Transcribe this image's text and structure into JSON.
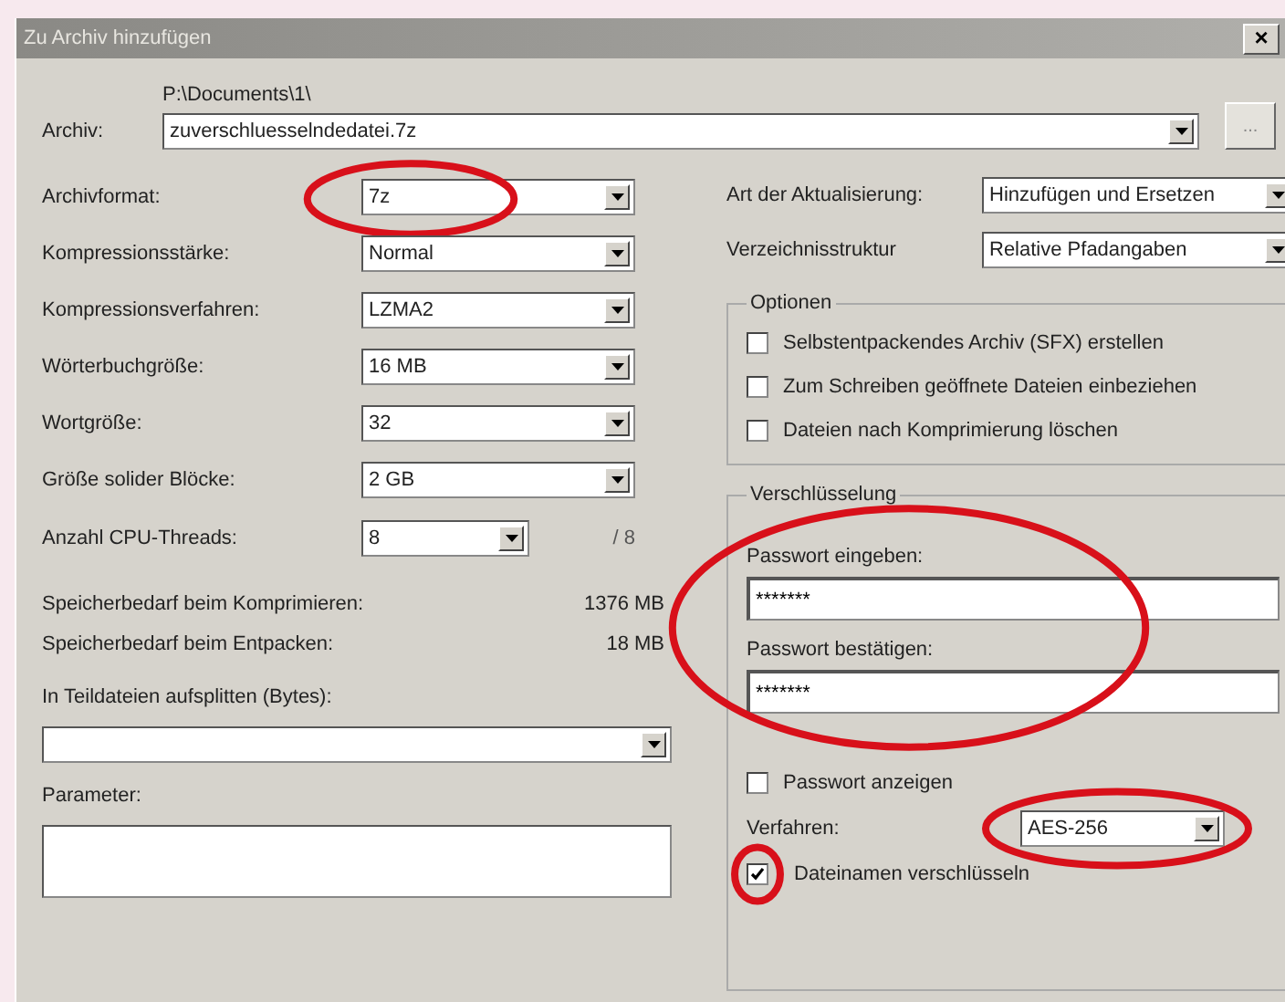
{
  "window": {
    "title": "Zu Archiv hinzufügen",
    "close": "×"
  },
  "archive": {
    "label": "Archiv:",
    "path": "P:\\Documents\\1\\",
    "value": "zuverschluesselndedatei.7z",
    "browse": "..."
  },
  "left_settings": [
    {
      "label": "Archivformat:",
      "value": "7z",
      "circled": true
    },
    {
      "label": "Kompressionsstärke:",
      "value": "Normal",
      "circled": false
    },
    {
      "label": "Kompressionsverfahren:",
      "value": "LZMA2",
      "circled": false
    },
    {
      "label": "Wörterbuchgröße:",
      "value": "16 MB",
      "circled": false
    },
    {
      "label": "Wortgröße:",
      "value": "32",
      "circled": false
    },
    {
      "label": "Größe solider Blöcke:",
      "value": "2 GB",
      "circled": false
    }
  ],
  "cpu_threads": {
    "label": "Anzahl CPU-Threads:",
    "value": "8",
    "max": "/ 8"
  },
  "memory": [
    {
      "label": "Speicherbedarf beim Komprimieren:",
      "value": "1376 MB"
    },
    {
      "label": "Speicherbedarf beim Entpacken:",
      "value": "18 MB"
    }
  ],
  "split": {
    "label": "In Teildateien aufsplitten (Bytes):"
  },
  "parameters": {
    "label": "Parameter:"
  },
  "right_settings": [
    {
      "label": "Art der Aktualisierung:",
      "value": "Hinzufügen und Ersetzen"
    },
    {
      "label": "Verzeichnisstruktur",
      "value": "Relative Pfadangaben"
    }
  ],
  "options": {
    "title": "Optionen",
    "items": [
      {
        "label": "Selbstentpackendes Archiv (SFX) erstellen",
        "checked": false
      },
      {
        "label": "Zum Schreiben geöffnete Dateien einbeziehen",
        "checked": false
      },
      {
        "label": "Dateien nach Komprimierung löschen",
        "checked": false
      }
    ]
  },
  "encryption": {
    "title": "Verschlüsselung",
    "passwords_circled": true,
    "password_fields": [
      {
        "label": "Passwort eingeben:",
        "value": "*******"
      },
      {
        "label": "Passwort bestätigen:",
        "value": "*******"
      }
    ],
    "show_password": {
      "label": "Passwort anzeigen",
      "checked": false
    },
    "method": {
      "label": "Verfahren:",
      "value": "AES-256",
      "circled": true
    },
    "encrypt_names": {
      "label": "Dateinamen verschlüsseln",
      "checked": true,
      "circled": true
    }
  }
}
